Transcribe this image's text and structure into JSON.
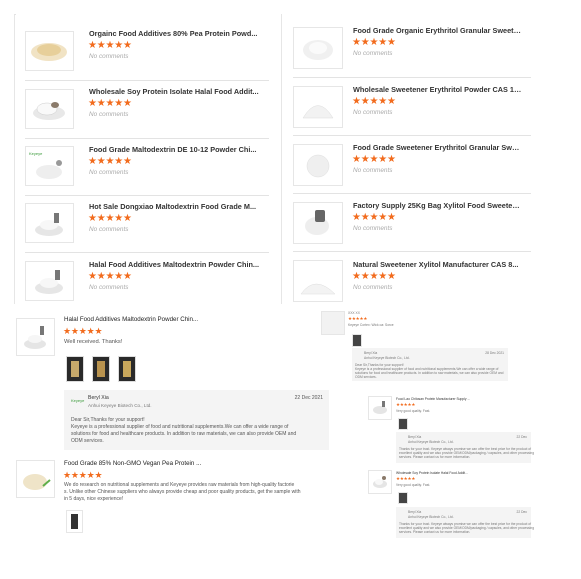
{
  "rating_icon": "star-icon",
  "accent_color": "#f26b1d",
  "top_products": {
    "left": [
      {
        "title": "Orgainc Food Additives 80% Pea Protein Powd...",
        "stars": "★★★★★",
        "comments": "No comments"
      },
      {
        "title": "Wholesale Soy Protein Isolate Halal Food Addit...",
        "stars": "★★★★★",
        "comments": "No comments"
      },
      {
        "title": "Food Grade Maltodextrin DE 10-12 Powder Chi...",
        "stars": "★★★★★",
        "comments": "No comments"
      },
      {
        "title": "Hot Sale Dongxiao Maltodextrin Food Grade M...",
        "stars": "★★★★★",
        "comments": "No comments"
      },
      {
        "title": "Halal Food Additives Maltodextrin Powder Chin...",
        "stars": "★★★★★",
        "comments": "No comments"
      }
    ],
    "right": [
      {
        "title": "Food Grade Organic Erythritol Granular Sweete...",
        "stars": "★★★★★",
        "comments": "No comments"
      },
      {
        "title": "Wholesale Sweetener Erythritol Powder CAS 149-32-6...",
        "stars": "★★★★★",
        "comments": "No comments"
      },
      {
        "title": "Food Grade Sweetener Erythritol Granular Sweetener ...",
        "stars": "★★★★★",
        "comments": "No comments"
      },
      {
        "title": "Factory Supply 25Kg Bag Xylitol Food Sweetener Xylit...",
        "stars": "★★★★★",
        "comments": "No comments"
      },
      {
        "title": "Natural Sweetener Xylitol Manufacturer CAS 8...",
        "stars": "★★★★★",
        "comments": "No comments"
      }
    ]
  },
  "reviews": [
    {
      "product": "Halal Food Additives Maltodextrin Powder Chin...",
      "stars": "★★★★★",
      "text": "Well received. Thanks!",
      "reply": {
        "name": "Beryl Xia",
        "company": "Anhui Keyeye Biotech Co., Ltd.",
        "date": "22 Dec 2021",
        "greeting": "Dear Sir,Thanks for your support!",
        "line1": "Keyeye is a professional supplier of food and nutritional supplements.We can offer a wide range of",
        "line2": "solutions for food and healthcare products. In addition to raw materials, we can also provide OEM and",
        "line3": "ODM services."
      }
    },
    {
      "product": "Food Grade 85% Non-GMO Vegan Pea Protein ...",
      "stars": "★★★★★",
      "line1": "We do research on nutritional supplements and Keyeye provides raw materials from high-quality factorie",
      "line2": "s. Unlike other Chinese suppliers who always provide cheap and poor quality products, get the sample with",
      "line3": "in 5 days, nice experience!"
    }
  ],
  "mini_reviews": {
    "top_title": "XXX XX",
    "top_stars": "★★★★★",
    "top_subline": "Keyeye Cortex: Wick oa: Sorce",
    "top_reply_name": "Beryl Xia",
    "top_reply_company": "Anhui Keyeye Biotech Co., Ltd.",
    "top_reply_date": "28 Dec 2021",
    "top_reply_line1": "Dear Sir,Thanks for your support!",
    "top_reply_line2": "Keyeye is a professional supplier of food and nutritional supplements.We can offer a wide range of",
    "top_reply_line3": "solutions for food and healthcare products. In addition to raw materials, we can also provide OEM and",
    "top_reply_line4": "ODM services.",
    "mid_title": "Food Lao Chitosan Protein Manufacturer Supply ...",
    "mid_stars": "★★★★★",
    "mid_text": "Very good quality. Fast.",
    "mid_reply_name": "Beryl Xia",
    "mid_reply_company": "Anhui Keyeye Biotech Co., Ltd.",
    "mid_reply_date": "22 Dec",
    "mid_reply_line1": "Thanks for your trust. Keyeye always promise we can offer the best price for the product of",
    "mid_reply_line2": "excellent quality and we also provide OEM/ODM/packaging / capsules, and other processing",
    "mid_reply_line3": "services. Please contact us for more information.",
    "bot_title": "Wholesale Soy Protein Isolate Halal Food Addit...",
    "bot_stars": "★★★★★",
    "bot_text": "Very good quality. Fast.",
    "bot_reply_name": "Beryl Xia",
    "bot_reply_company": "Anhui Keyeye Biotech Co., Ltd.",
    "bot_reply_date": "22 Dec",
    "bot_reply_line1": "Thanks for your trust. Keyeye always promise we can offer the best price for the product of",
    "bot_reply_line2": "excellent quality and we also provide OEM/ODM/packaging / capsules, and other processing",
    "bot_reply_line3": "services. Please contact us for more information."
  }
}
